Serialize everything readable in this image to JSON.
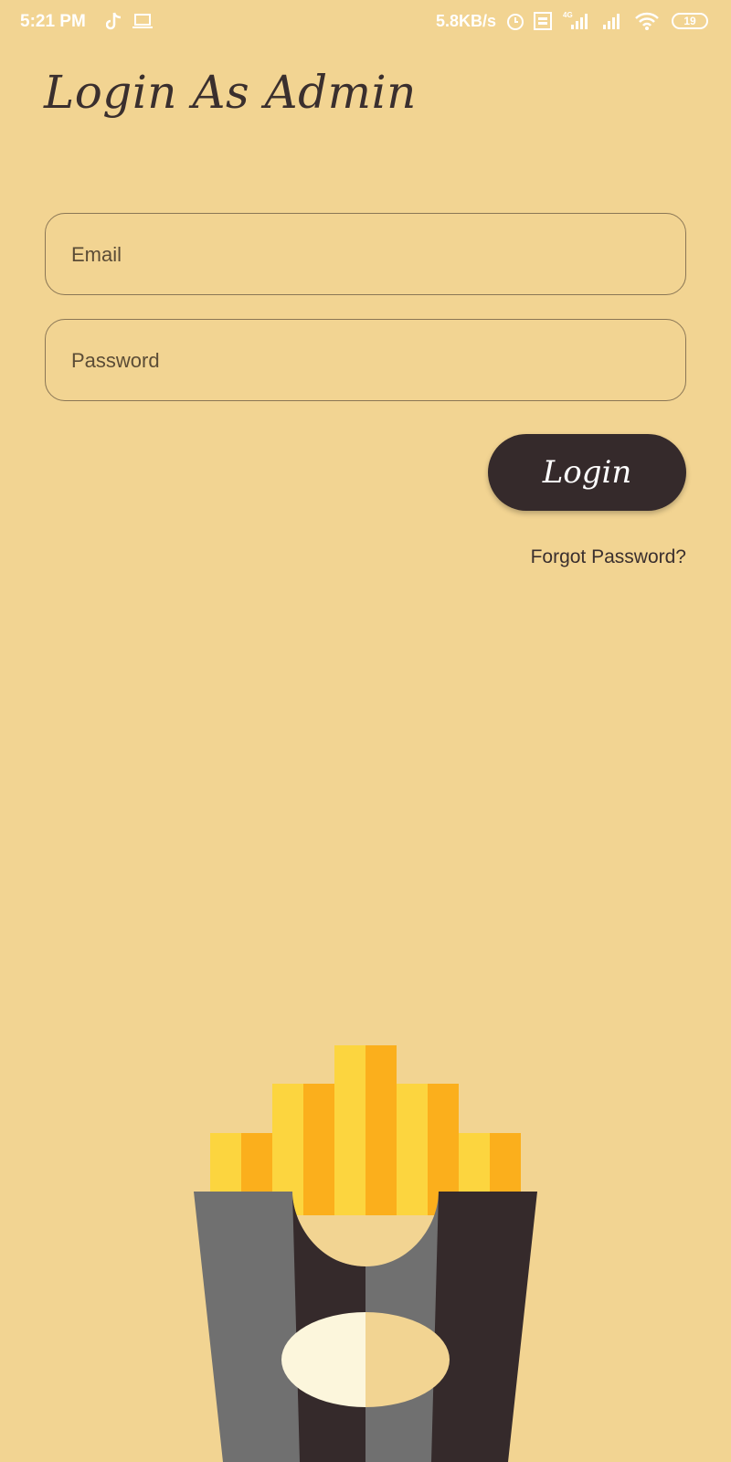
{
  "status_bar": {
    "time": "5:21 PM",
    "network_speed": "5.8KB/s",
    "battery": "19",
    "icons": [
      "tiktok-icon",
      "laptop-icon",
      "alarm-icon",
      "volte-icon",
      "signal-4g-icon",
      "signal-icon",
      "wifi-icon",
      "battery-icon"
    ]
  },
  "header": {
    "title": "Login As Admin"
  },
  "form": {
    "email_placeholder": "Email",
    "password_placeholder": "Password",
    "login_label": "Login",
    "forgot_label": "Forgot Password?"
  },
  "colors": {
    "background": "#f2d492",
    "button": "#352a2b",
    "fries_yellow": "#fcd53f",
    "fries_orange": "#fbaf1c",
    "box_gray": "#707070",
    "box_dark": "#352a2b"
  },
  "illustration": {
    "name": "french-fries-icon"
  }
}
